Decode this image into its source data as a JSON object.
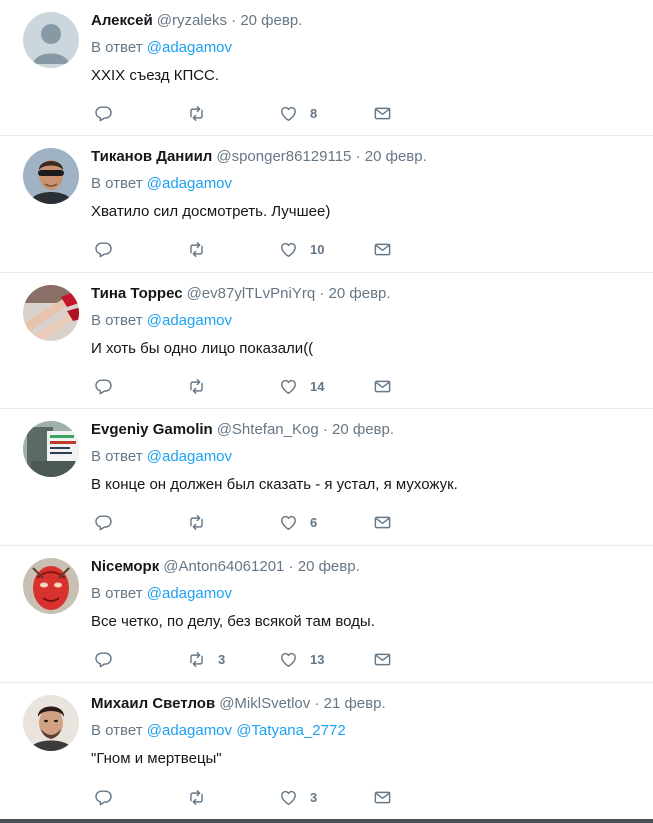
{
  "reply_prefix": "В ответ",
  "tweets": [
    {
      "name": "Алексей",
      "handle": "@ryzaleks",
      "date": "20 февр.",
      "mentions": [
        "@adagamov"
      ],
      "text": "XXIX съезд КПСС.",
      "replies": "",
      "retweets": "",
      "likes": "8",
      "avatar": "default-avatar"
    },
    {
      "name": "Тиканов Даниил",
      "handle": "@sponger86129115",
      "date": "20 февр.",
      "mentions": [
        "@adagamov"
      ],
      "text": "Хватило сил досмотреть. Лучшее)",
      "replies": "",
      "retweets": "",
      "likes": "10",
      "avatar": "man-sunglasses"
    },
    {
      "name": "Тина Торрес",
      "handle": "@ev87ylTLvPniYrq",
      "date": "20 февр.",
      "mentions": [
        "@adagamov"
      ],
      "text": "И хоть бы одно лицо показали((",
      "replies": "",
      "retweets": "",
      "likes": "14",
      "avatar": "legs-red-shoes"
    },
    {
      "name": "Evgeniy Gamolin",
      "handle": "@Shtefan_Kog",
      "date": "20 февр.",
      "mentions": [
        "@adagamov"
      ],
      "text": "В конце он должен был сказать - я устал, я мухожук.",
      "replies": "",
      "retweets": "",
      "likes": "6",
      "avatar": "poster-photo"
    },
    {
      "name": "Nicеморк",
      "handle": "@Anton64061201",
      "date": "20 февр.",
      "mentions": [
        "@adagamov"
      ],
      "text": "Все четко, по делу, без всякой там воды.",
      "replies": "",
      "retweets": "3",
      "likes": "13",
      "avatar": "red-face-mask"
    },
    {
      "name": "Михаил Светлов",
      "handle": "@MiklSvetlov",
      "date": "21 февр.",
      "mentions": [
        "@adagamov",
        "@Tatyana_2772"
      ],
      "text": "\"Гном и мертвецы\"",
      "replies": "",
      "retweets": "",
      "likes": "3",
      "avatar": "man-portrait"
    }
  ],
  "colors": {
    "link": "#1da1f2",
    "secondary_text": "#657786",
    "primary_text": "#14171a",
    "divider": "#e6ecf0"
  },
  "icons": {
    "reply": "reply-icon",
    "retweet": "retweet-icon",
    "like": "heart-icon",
    "dm": "envelope-icon"
  }
}
